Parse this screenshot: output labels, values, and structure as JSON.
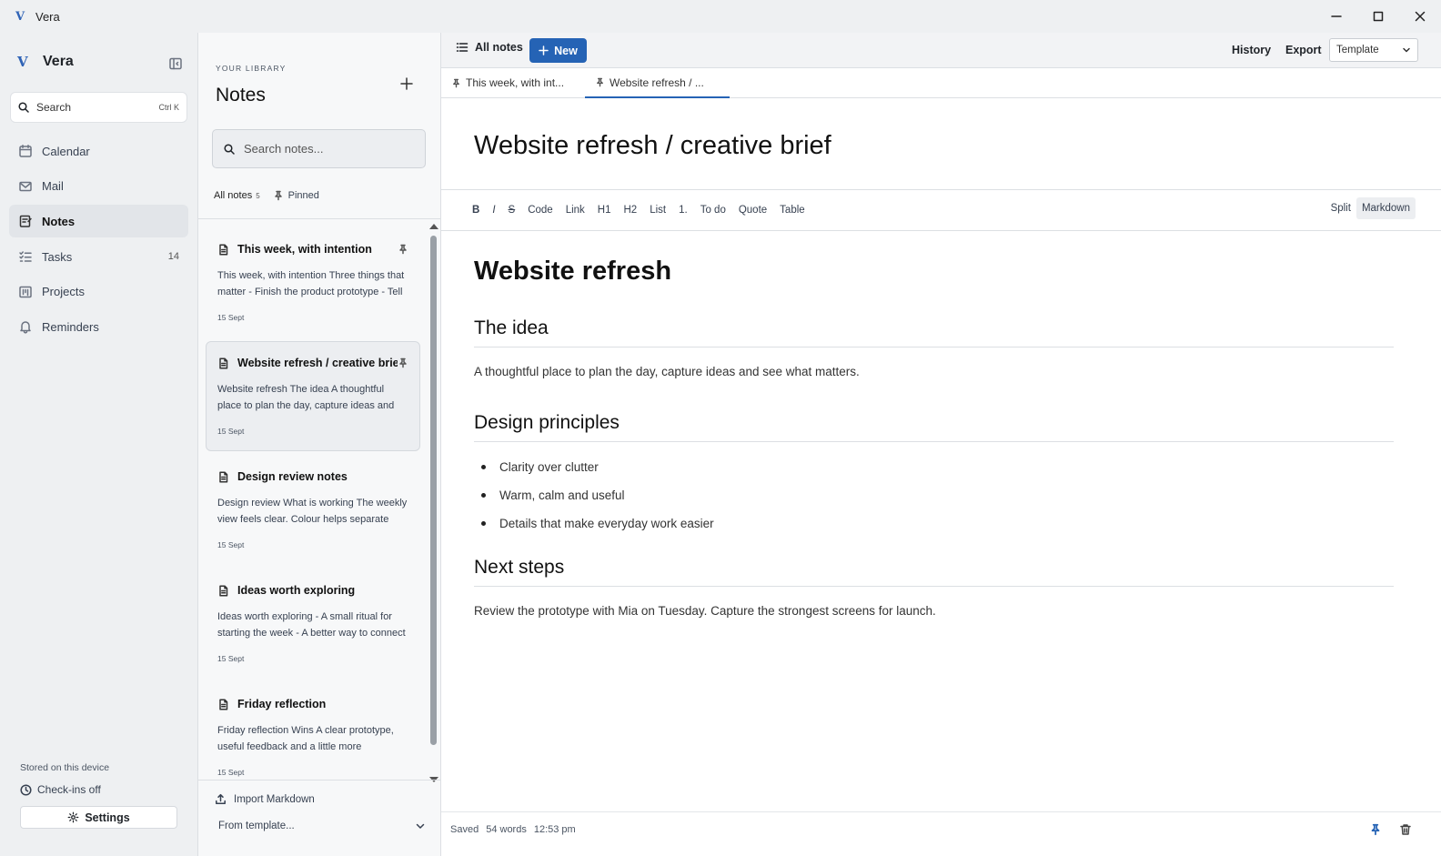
{
  "window": {
    "logo": "V",
    "title": "Vera",
    "controls": [
      "minimize-icon",
      "maximize-icon",
      "close-icon"
    ]
  },
  "sidebar": {
    "brand_mark": "V",
    "brand_name": "Vera",
    "search_label": "Search",
    "search_shortcut": "Ctrl K",
    "items": [
      {
        "label": "Calendar",
        "icon": "calendar-icon",
        "count": ""
      },
      {
        "label": "Mail",
        "icon": "mail-icon",
        "count": ""
      },
      {
        "label": "Notes",
        "icon": "notes-icon",
        "count": "",
        "active": true
      },
      {
        "label": "Tasks",
        "icon": "tasks-icon",
        "count": "14"
      },
      {
        "label": "Projects",
        "icon": "projects-icon",
        "count": ""
      },
      {
        "label": "Reminders",
        "icon": "bell-icon",
        "count": ""
      }
    ],
    "stored_label": "Stored on this device",
    "checkins_label": "Check-ins off",
    "settings_label": "Settings"
  },
  "notes_panel": {
    "library_label": "YOUR LIBRARY",
    "title": "Notes",
    "search_placeholder": "Search notes...",
    "filter_all": "All notes",
    "filter_count": "5",
    "filter_pinned": "Pinned",
    "notes": [
      {
        "title": "This week, with intention",
        "excerpt": "This week, with intention Three things that matter - Finish the product prototype - Tell",
        "date": "15 Sept",
        "pinned": true,
        "selected": false
      },
      {
        "title": "Website refresh / creative brief",
        "excerpt": "Website refresh The idea A thoughtful place to plan the day, capture ideas and",
        "date": "15 Sept",
        "pinned": true,
        "selected": true
      },
      {
        "title": "Design review notes",
        "excerpt": "Design review What is working The weekly view feels clear. Colour helps separate",
        "date": "15 Sept",
        "pinned": false,
        "selected": false
      },
      {
        "title": "Ideas worth exploring",
        "excerpt": "Ideas worth exploring - A small ritual for starting the week - A better way to connect",
        "date": "15 Sept",
        "pinned": false,
        "selected": false
      },
      {
        "title": "Friday reflection",
        "excerpt": "Friday reflection Wins A clear prototype, useful feedback and a little more",
        "date": "15 Sept",
        "pinned": false,
        "selected": false
      }
    ],
    "import_label": "Import Markdown",
    "from_template_label": "From template..."
  },
  "toolbar": {
    "all_notes_label": "All notes",
    "new_label": "New",
    "history_label": "History",
    "export_label": "Export",
    "template_label": "Template"
  },
  "tabs": [
    {
      "label": "This week, with int...",
      "active": false
    },
    {
      "label": "Website refresh / ...",
      "active": true
    }
  ],
  "editor": {
    "title": "Website refresh / creative brief",
    "format_buttons": [
      "B",
      "I",
      "S",
      "Code",
      "Link",
      "H1",
      "H2",
      "List",
      "1.",
      "To do",
      "Quote",
      "Table"
    ],
    "view_split": "Split",
    "view_markdown": "Markdown",
    "content": {
      "heading": "Website refresh",
      "section1_heading": "The idea",
      "section1_text": "A thoughtful place to plan the day, capture ideas and see what matters.",
      "section2_heading": "Design principles",
      "section2_items": [
        "Clarity over clutter",
        "Warm, calm and useful",
        "Details that make everyday work easier"
      ],
      "section3_heading": "Next steps",
      "section3_text": "Review the prototype with Mia on Tuesday. Capture the strongest screens for launch."
    }
  },
  "status": {
    "saved": "Saved",
    "words": "54 words",
    "time": "12:53 pm"
  },
  "colors": {
    "accent": "#2563b5",
    "sidebar_bg": "#eef0f2",
    "panel_bg": "#f7f8f9"
  }
}
